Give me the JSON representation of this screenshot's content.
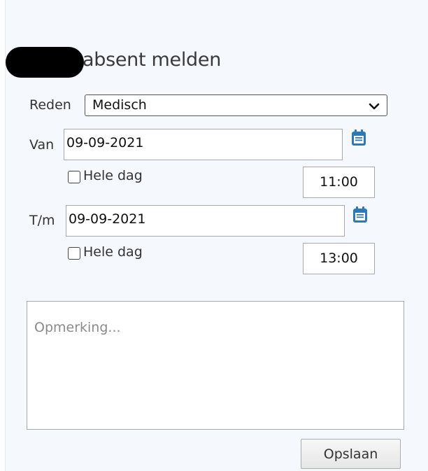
{
  "form": {
    "title": "absent melden",
    "reason": {
      "label": "Reden",
      "value": "Medisch"
    },
    "from": {
      "label": "Van",
      "date": "09-09-2021",
      "whole_day_label": "Hele dag",
      "whole_day_checked": false,
      "time": "11:00"
    },
    "to": {
      "label": "T/m",
      "date": "09-09-2021",
      "whole_day_label": "Hele dag",
      "whole_day_checked": false,
      "time": "13:00"
    },
    "remark": {
      "placeholder": "Opmerking..."
    },
    "save_label": "Opslaan"
  },
  "icons": {
    "calendar": "calendar-icon",
    "chevron": "chevron-down-icon"
  },
  "colors": {
    "calendar_icon": "#2e78b8",
    "panel_background": "#f5f8fc"
  }
}
